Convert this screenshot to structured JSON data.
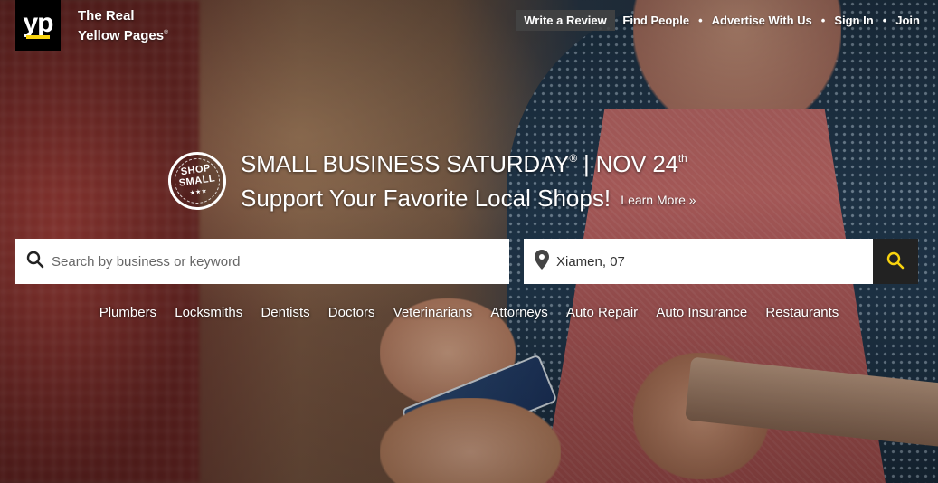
{
  "brand": {
    "logo_text": "yp",
    "tagline_line1": "The Real",
    "tagline_line2": "Yellow Pages",
    "tagline_mark": "®",
    "accent_color": "#f8d30f"
  },
  "header": {
    "write_review_label": "Write a Review",
    "nav": [
      {
        "label": "Find People"
      },
      {
        "label": "Advertise With Us"
      },
      {
        "label": "Sign In"
      },
      {
        "label": "Join"
      }
    ],
    "separator": "•"
  },
  "promo": {
    "badge_line1": "SHOP",
    "badge_line2": "SMALL",
    "badge_stars": "★★★",
    "title_main": "SMALL BUSINESS SATURDAY",
    "title_reg": "®",
    "title_sep": " | NOV 24",
    "title_suffix": "th",
    "subtitle": "Support Your Favorite Local Shops!",
    "learn_more": "Learn More »"
  },
  "search": {
    "what_placeholder": "Search by business or keyword",
    "what_value": "",
    "where_value": "Xiamen, 07",
    "icons": [
      "search-icon",
      "location-pin-icon"
    ]
  },
  "categories": [
    {
      "label": "Plumbers"
    },
    {
      "label": "Locksmiths"
    },
    {
      "label": "Dentists"
    },
    {
      "label": "Doctors"
    },
    {
      "label": "Veterinarians"
    },
    {
      "label": "Attorneys"
    },
    {
      "label": "Auto Repair"
    },
    {
      "label": "Auto Insurance"
    },
    {
      "label": "Restaurants"
    }
  ]
}
